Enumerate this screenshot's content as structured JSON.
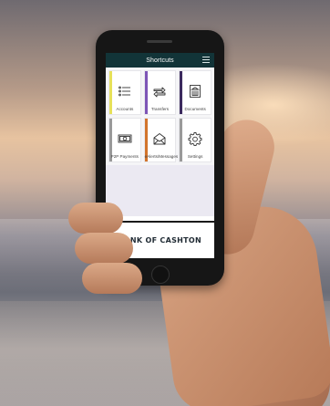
{
  "app": {
    "title": "Shortcuts",
    "menu_icon": "hamburger-icon"
  },
  "tiles": [
    {
      "label": "Accounts",
      "icon": "list-icon",
      "accent": "#e7e15a"
    },
    {
      "label": "Transfers",
      "icon": "arrows-icon",
      "accent": "#7d55b6"
    },
    {
      "label": "Documents",
      "icon": "building-icon",
      "accent": "#3b2a5e"
    },
    {
      "label": "P2P Payments",
      "icon": "money-icon",
      "accent": "#9a9a9a"
    },
    {
      "label": "eAlerts/Messages",
      "icon": "envelope-icon",
      "accent": "#d2742c"
    },
    {
      "label": "Settings",
      "icon": "gear-icon",
      "accent": "#9a9a9a"
    }
  ],
  "brand": {
    "name": "BANK OF CASHTON"
  },
  "colors": {
    "header": "#123438",
    "icon_stroke": "#333333"
  }
}
